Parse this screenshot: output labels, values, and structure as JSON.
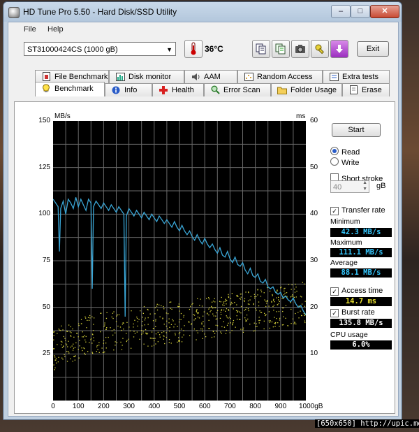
{
  "window": {
    "title": "HD Tune Pro 5.50 - Hard Disk/SSD Utility",
    "minimize_glyph": "–",
    "maximize_glyph": "□",
    "close_glyph": "✕"
  },
  "menu": {
    "file": "File",
    "help": "Help"
  },
  "toolbar": {
    "drive": "ST31000424CS (1000 gB)",
    "temperature": "36°C",
    "icons": [
      "thermometer-icon",
      "copy-text-icon",
      "copy-info-icon",
      "camera-icon",
      "tools-icon",
      "download-icon"
    ],
    "exit_label": "Exit"
  },
  "tabs_top": [
    {
      "label": "File Benchmark",
      "icon": "file-benchmark-icon"
    },
    {
      "label": "Disk monitor",
      "icon": "disk-monitor-icon"
    },
    {
      "label": "AAM",
      "icon": "speaker-icon"
    },
    {
      "label": "Random Access",
      "icon": "random-access-icon"
    },
    {
      "label": "Extra tests",
      "icon": "extra-tests-icon"
    }
  ],
  "tabs_bottom": [
    {
      "label": "Benchmark",
      "icon": "benchmark-icon",
      "active": true
    },
    {
      "label": "Info",
      "icon": "info-icon"
    },
    {
      "label": "Health",
      "icon": "health-cross-icon"
    },
    {
      "label": "Error Scan",
      "icon": "error-scan-icon"
    },
    {
      "label": "Folder Usage",
      "icon": "folder-icon"
    },
    {
      "label": "Erase",
      "icon": "erase-icon"
    }
  ],
  "controls": {
    "start_label": "Start",
    "read_label": "Read",
    "write_label": "Write",
    "short_stroke_label": "Short stroke",
    "short_stroke_value": "40",
    "short_stroke_unit": "gB",
    "transfer_rate_label": "Transfer rate",
    "minimum_label": "Minimum",
    "minimum_value": "42.3 MB/s",
    "maximum_label": "Maximum",
    "maximum_value": "111.1 MB/s",
    "average_label": "Average",
    "average_value": "88.1 MB/s",
    "access_time_label": "Access time",
    "access_time_value": "14.7 ms",
    "burst_rate_label": "Burst rate",
    "burst_rate_value": "135.8 MB/s",
    "cpu_usage_label": "CPU usage",
    "cpu_usage_value": "6.0%"
  },
  "colors": {
    "transfer_line": "#3aa6d6",
    "access_points": "#d6d23a",
    "chart_bg": "#000000",
    "grid": "#6a6a6a",
    "stat_cyan": "#35c8ff",
    "stat_yellow": "#e8e030",
    "stat_white": "#ffffff"
  },
  "chart_data": {
    "type": "line",
    "left_unit": "MB/s",
    "right_unit": "ms",
    "x_ticks": [
      "0",
      "100",
      "200",
      "300",
      "400",
      "500",
      "600",
      "700",
      "800",
      "900",
      "1000gB"
    ],
    "y_left_ticks": [
      "150",
      "125",
      "100",
      "75",
      "50",
      "25"
    ],
    "y_right_ticks": [
      "60",
      "50",
      "40",
      "30",
      "20",
      "10"
    ],
    "xlim": [
      0,
      1000
    ],
    "ylim_left": [
      0,
      150
    ],
    "ylim_right": [
      0,
      60
    ],
    "grid": true,
    "series": [
      {
        "role": "transfer_rate",
        "axis": "left",
        "x": [
          0,
          10,
          20,
          25,
          30,
          40,
          50,
          60,
          70,
          80,
          90,
          100,
          110,
          120,
          130,
          140,
          150,
          155,
          160,
          170,
          180,
          190,
          200,
          210,
          220,
          230,
          240,
          250,
          260,
          270,
          280,
          285,
          290,
          300,
          310,
          320,
          330,
          340,
          350,
          360,
          370,
          380,
          390,
          400,
          410,
          420,
          430,
          440,
          450,
          460,
          470,
          480,
          490,
          500,
          510,
          520,
          530,
          540,
          550,
          560,
          570,
          580,
          590,
          600,
          610,
          620,
          630,
          640,
          650,
          660,
          670,
          680,
          690,
          700,
          710,
          720,
          730,
          740,
          750,
          760,
          770,
          780,
          790,
          800,
          810,
          820,
          830,
          840,
          850,
          860,
          870,
          880,
          890,
          900,
          910,
          920,
          930,
          940,
          950,
          960,
          970,
          980,
          990,
          1000
        ],
        "values": [
          108,
          106,
          104,
          80,
          103,
          107,
          100,
          108,
          106,
          103,
          109,
          104,
          108,
          105,
          102,
          108,
          106,
          60,
          104,
          107,
          105,
          103,
          106,
          104,
          102,
          105,
          103,
          101,
          104,
          102,
          100,
          45,
          99,
          103,
          101,
          99,
          102,
          100,
          98,
          101,
          99,
          97,
          100,
          98,
          96,
          99,
          97,
          95,
          97,
          95,
          93,
          96,
          93,
          91,
          94,
          91,
          89,
          91,
          88,
          86,
          89,
          86,
          84,
          87,
          84,
          82,
          84,
          81,
          79,
          82,
          78,
          77,
          80,
          76,
          74,
          77,
          73,
          72,
          74,
          70,
          68,
          71,
          67,
          66,
          68,
          64,
          63,
          65,
          61,
          60,
          61,
          58,
          57,
          58,
          55,
          56,
          54,
          53,
          55,
          52,
          50,
          51,
          48,
          46
        ]
      },
      {
        "role": "access_time",
        "axis": "right",
        "style": "scatter",
        "x": [
          0,
          25,
          50,
          75,
          100,
          125,
          150,
          175,
          200,
          225,
          250,
          275,
          300,
          325,
          350,
          375,
          400,
          425,
          450,
          475,
          500,
          525,
          550,
          575,
          600,
          625,
          650,
          675,
          700,
          725,
          750,
          775,
          800,
          825,
          850,
          875,
          900,
          925,
          950,
          975,
          1000
        ],
        "values": [
          11,
          12,
          12.5,
          13,
          13.5,
          14,
          14.2,
          14.5,
          14.7,
          15,
          15,
          15.2,
          15.5,
          15.7,
          16,
          16,
          16.3,
          16.5,
          16.7,
          17,
          17,
          17.3,
          17.5,
          17.7,
          18,
          18,
          18.3,
          18.5,
          18.7,
          19,
          19,
          19.3,
          19.5,
          19.7,
          20,
          20,
          20.3,
          20.5,
          20.7,
          21,
          21
        ]
      }
    ]
  },
  "watermark": "[650x650] http://upic.me/"
}
